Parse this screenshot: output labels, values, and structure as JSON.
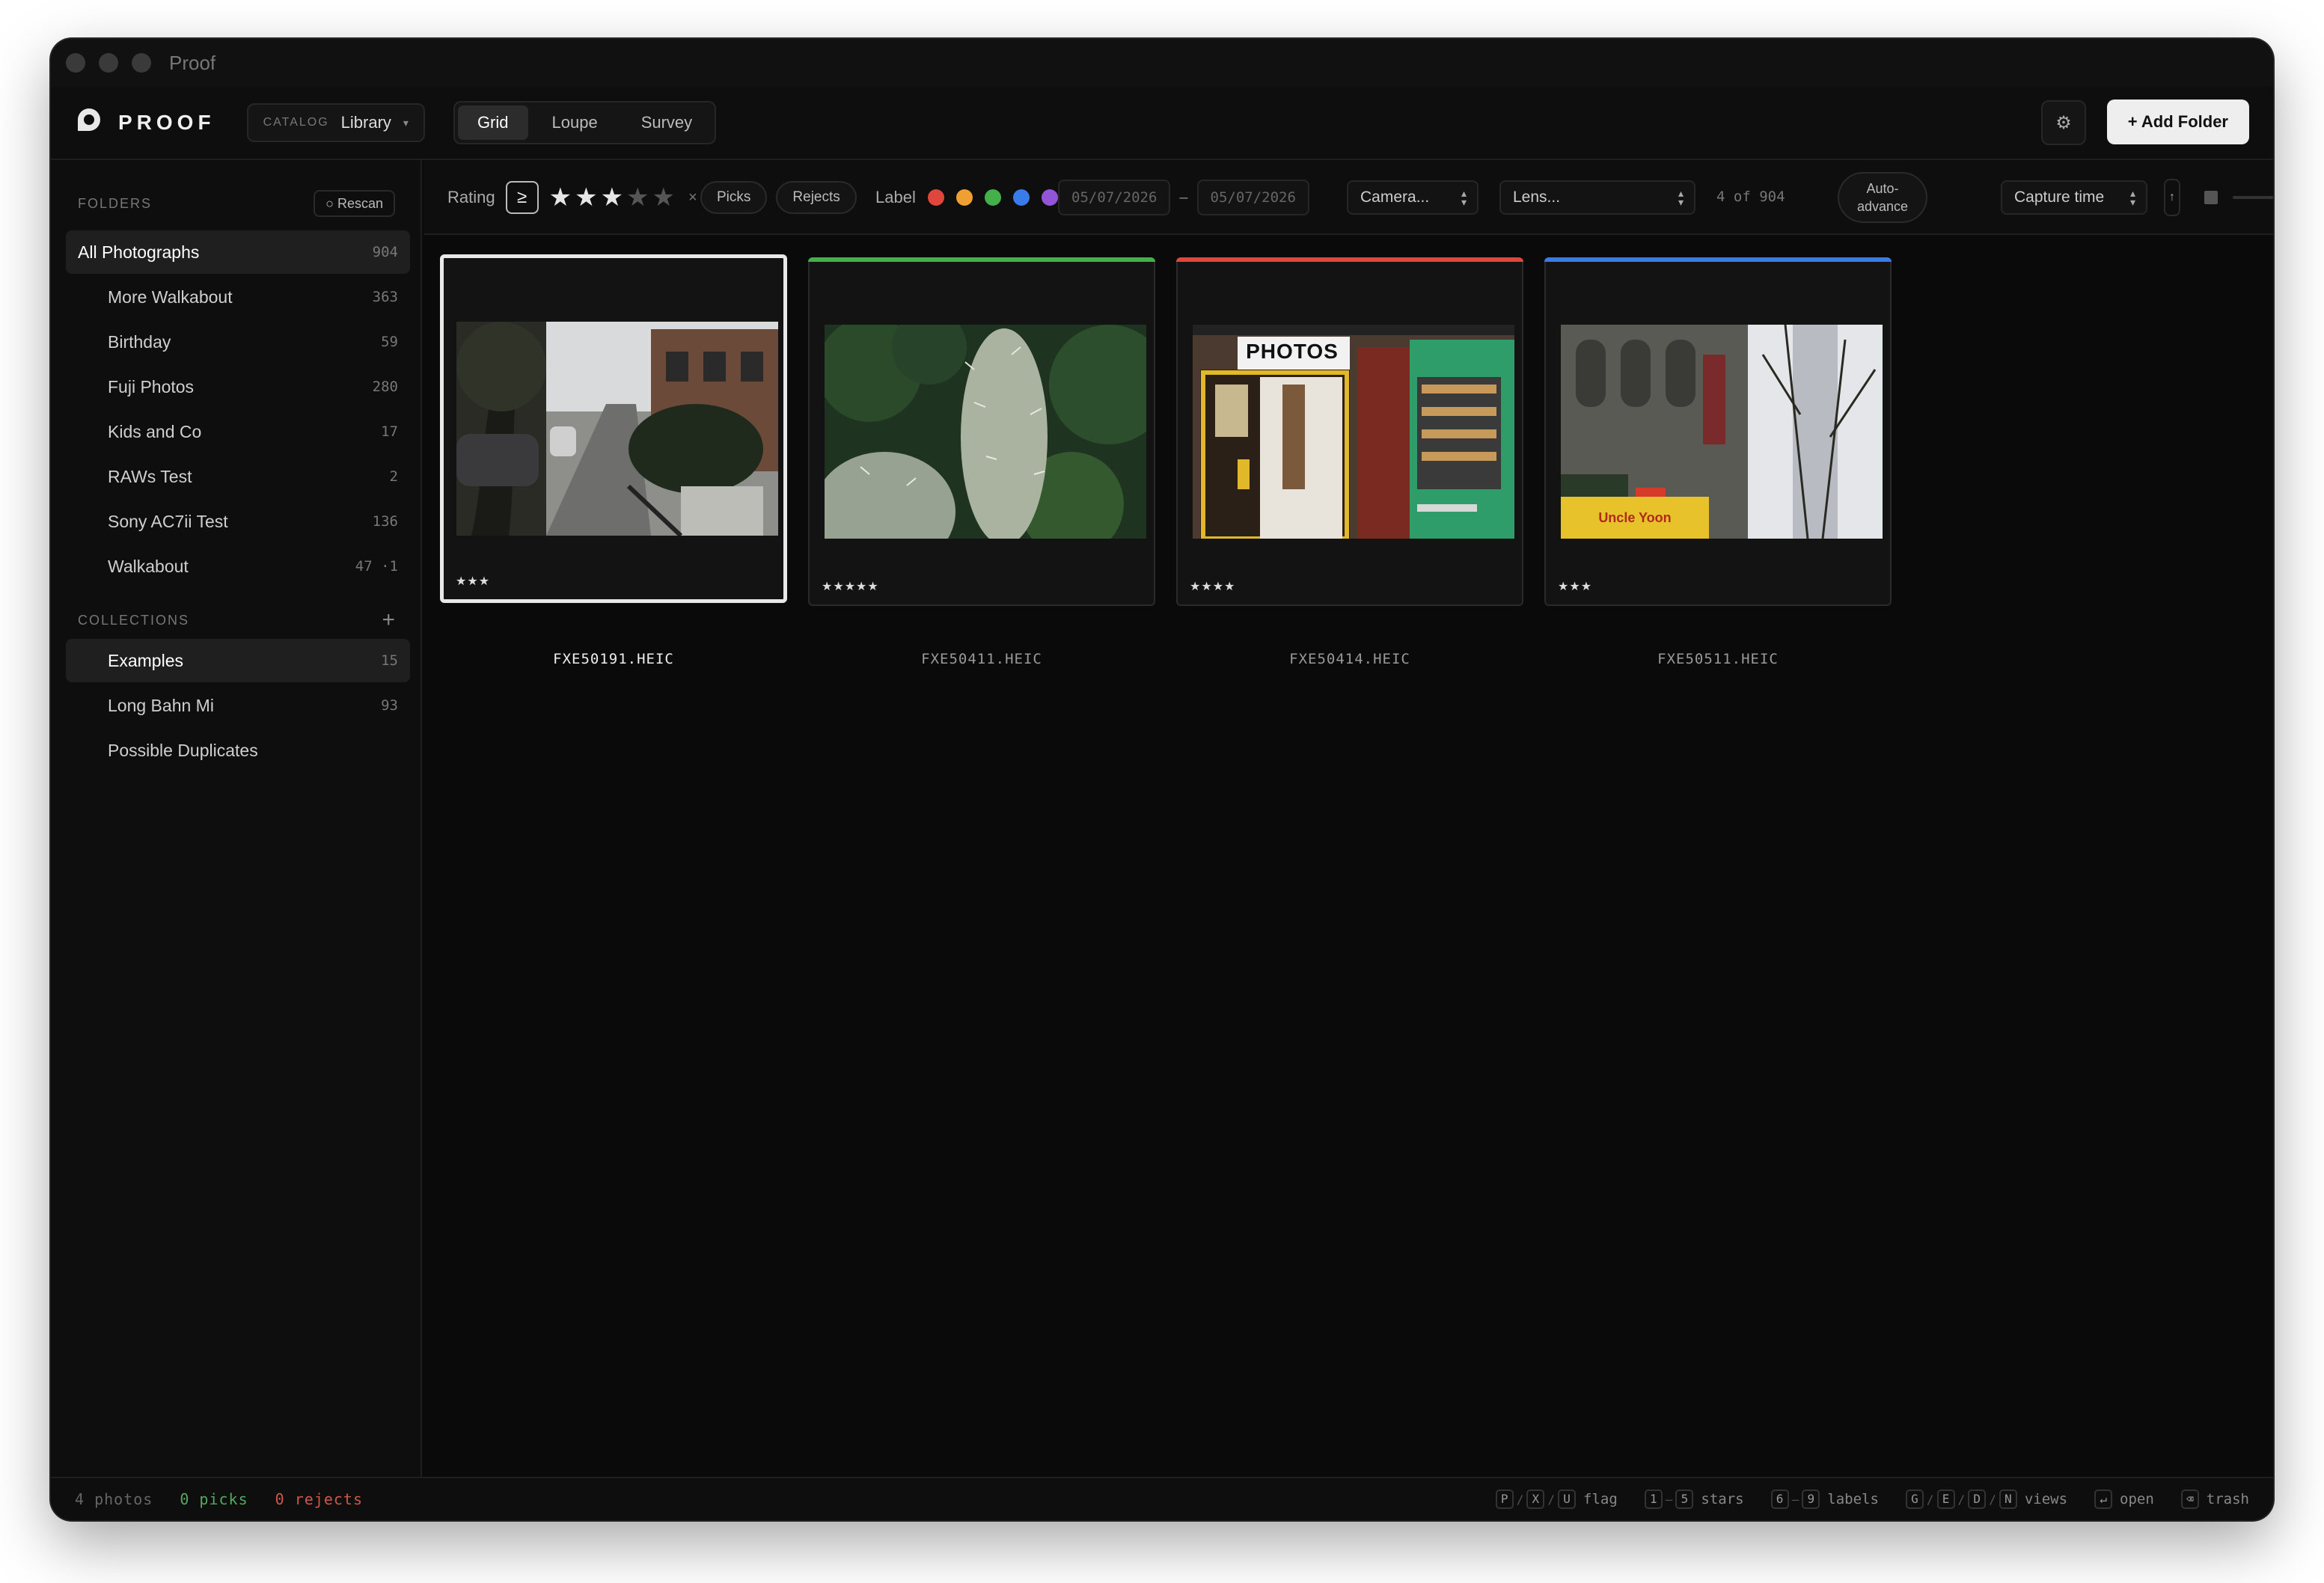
{
  "window": {
    "title": "Proof"
  },
  "header": {
    "logo_text": "PROOF",
    "catalog_small": "CATALOG",
    "catalog_name": "Library",
    "views": [
      "Grid",
      "Loupe",
      "Survey"
    ],
    "active_view": "Grid",
    "add_folder_label": "+ Add Folder"
  },
  "sidebar": {
    "folders_title": "FOLDERS",
    "rescan_label": "○ Rescan",
    "folders": [
      {
        "label": "All Photographs",
        "count": "904",
        "selected": true
      },
      {
        "label": "More Walkabout",
        "count": "363"
      },
      {
        "label": "Birthday",
        "count": "59"
      },
      {
        "label": "Fuji Photos",
        "count": "280"
      },
      {
        "label": "Kids and Co",
        "count": "17"
      },
      {
        "label": "RAWs Test",
        "count": "2"
      },
      {
        "label": "Sony AC7ii Test",
        "count": "136"
      },
      {
        "label": "Walkabout",
        "count": "47 ·1"
      }
    ],
    "collections_title": "COLLECTIONS",
    "collections_add": "+",
    "collections": [
      {
        "label": "Examples",
        "count": "15",
        "selected": true
      },
      {
        "label": "Long Bahn Mi",
        "count": "93"
      },
      {
        "label": "Possible Duplicates",
        "count": ""
      }
    ]
  },
  "filters": {
    "rating_label": "Rating",
    "rating_operator": "≥",
    "rating_value": 3,
    "rating_max": 5,
    "clear": "×",
    "picks_label": "Picks",
    "rejects_label": "Rejects",
    "label_label": "Label",
    "label_colors": [
      "#e0463c",
      "#f0a030",
      "#43b04a",
      "#3a7bea",
      "#9355d8"
    ],
    "date_from": "05/07/2026",
    "date_dash": "–",
    "date_to": "05/07/2026",
    "camera_placeholder": "Camera...",
    "lens_placeholder": "Lens...",
    "count_text": "4 of 904",
    "auto_advance": "Auto-\nadvance",
    "sort_label": "Capture time",
    "sort_dir": "↑"
  },
  "photos": [
    {
      "filename": "FXE50191.HEIC",
      "rating": "★★★",
      "label_color": "",
      "selected": true,
      "icon": "street-photo"
    },
    {
      "filename": "FXE50411.HEIC",
      "rating": "★★★★★",
      "label_color": "#43b04a",
      "selected": false,
      "icon": "cactus-photo"
    },
    {
      "filename": "FXE50414.HEIC",
      "rating": "★★★★",
      "label_color": "#e0463c",
      "selected": false,
      "icon": "photobooth-photo",
      "sign_text": "PHOTOS"
    },
    {
      "filename": "FXE50511.HEIC",
      "rating": "★★★",
      "label_color": "#3a7bea",
      "selected": false,
      "icon": "building-photo",
      "sign_text": "Uncle Yoon"
    }
  ],
  "status": {
    "photos": "4 photos",
    "picks": "0 picks",
    "rejects": "0 rejects",
    "hints": [
      {
        "keys": [
          "P",
          "X",
          "U"
        ],
        "sep": "/",
        "label": "flag"
      },
      {
        "keys": [
          "1",
          "5"
        ],
        "sep": "–",
        "label": "stars"
      },
      {
        "keys": [
          "6",
          "9"
        ],
        "sep": "–",
        "label": "labels"
      },
      {
        "keys": [
          "G",
          "E",
          "D",
          "N"
        ],
        "sep": "/",
        "label": "views"
      },
      {
        "keys": [
          "↵"
        ],
        "sep": "",
        "label": "open"
      },
      {
        "keys": [
          "⌫"
        ],
        "sep": "",
        "label": "trash"
      }
    ]
  }
}
